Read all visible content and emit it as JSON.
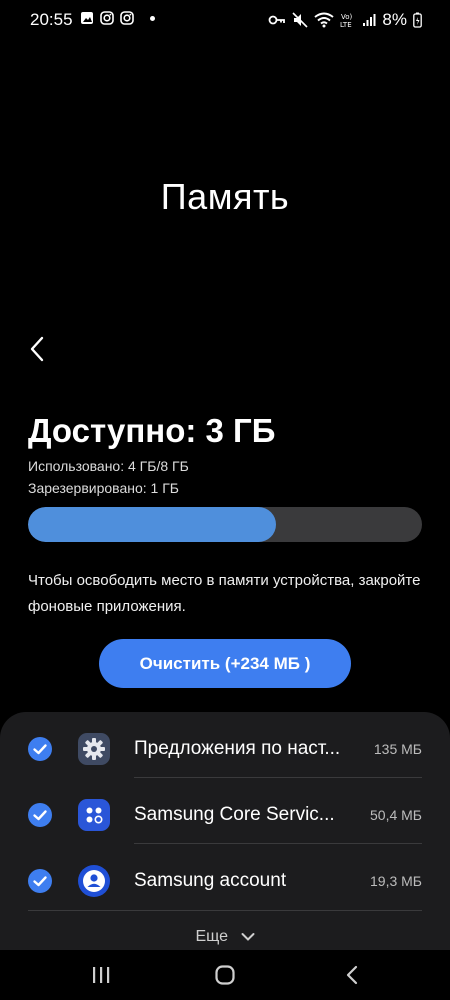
{
  "status_bar": {
    "time": "20:55",
    "battery": "8%",
    "left_icons": [
      "gallery-icon",
      "instagram-icon",
      "instagram-icon",
      "notification-dot"
    ],
    "right_icons": [
      "vpn-key-icon",
      "mute-icon",
      "wifi-icon",
      "volte-icon",
      "signal-icon",
      "battery-icon"
    ]
  },
  "page": {
    "title": "Память"
  },
  "memory": {
    "available": "Доступно: 3 ГБ",
    "used": "Использовано: 4 ГБ/8 ГБ",
    "reserved": "Зарезервировано: 1 ГБ",
    "used_fraction": 0.63,
    "hint": "Чтобы освободить место в памяти устройства, закройте фоновые приложения."
  },
  "clean_button": {
    "label": "Очистить (+234 МБ )"
  },
  "apps": [
    {
      "name": "Предложения по наст...",
      "size": "135 МБ",
      "icon": "settings-gear-icon",
      "checked": true
    },
    {
      "name": "Samsung Core Servic...",
      "size": "50,4 МБ",
      "icon": "samsung-core-services-icon",
      "checked": true
    },
    {
      "name": "Samsung account",
      "size": "19,3 МБ",
      "icon": "samsung-account-icon",
      "checked": true
    }
  ],
  "more": {
    "label": "Еще"
  },
  "colors": {
    "accent": "#3e7ef0",
    "progress": "#4f8fdc",
    "panel": "#1c1c1e",
    "background": "#000000"
  }
}
